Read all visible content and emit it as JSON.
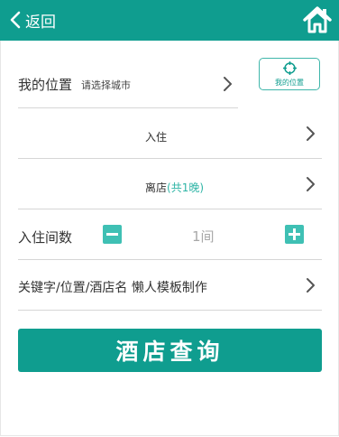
{
  "header": {
    "back_label": "返回"
  },
  "location": {
    "label": "我的位置",
    "placeholder": "请选择城市",
    "my_location_button": "我的位置"
  },
  "checkin": {
    "label": "入住"
  },
  "checkout": {
    "label": "离店",
    "nights": "(共1晚)"
  },
  "rooms": {
    "label": "入住间数",
    "value": "1间"
  },
  "keyword": {
    "text": "关键字/位置/酒店名 懒人模板制作"
  },
  "search_button": {
    "label": "酒店查询"
  },
  "icons": {
    "back": "chevron-left-icon",
    "home": "home-icon",
    "row_chevron": "chevron-right-icon",
    "locate": "crosshair-icon",
    "minus": "minus-icon",
    "plus": "plus-icon"
  },
  "colors": {
    "primary": "#0f9d8f",
    "accent": "#3fc0b4",
    "nights_text": "#2fb5a6",
    "divider": "#d6d6d6"
  }
}
